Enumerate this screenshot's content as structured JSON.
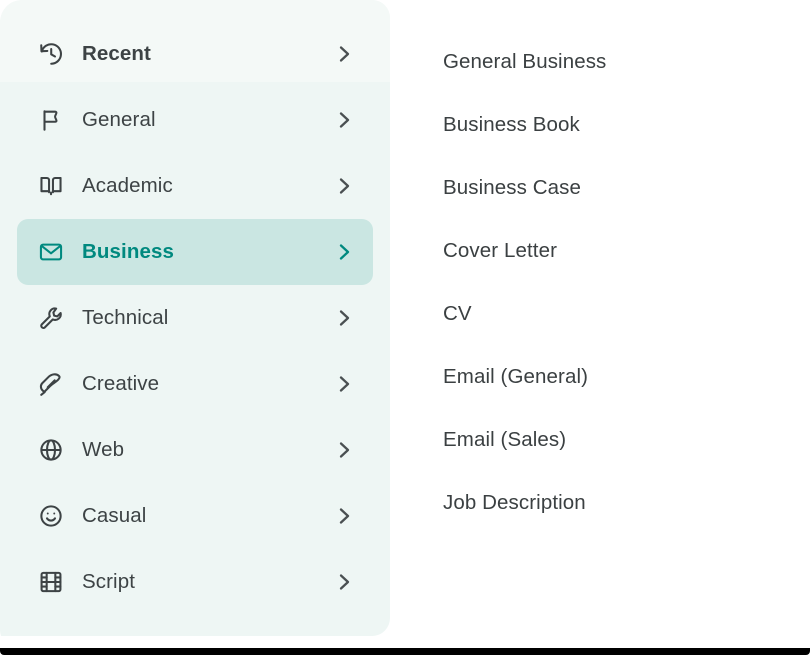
{
  "colors": {
    "sidebar_bg": "#eef6f4",
    "sidebar_top_band": "#f4f9f7",
    "active_row_bg": "#cae6e2",
    "accent_teal": "#00897f",
    "text_default": "#3d4345",
    "detail_bg": "#ffffff",
    "page_edge": "#000000"
  },
  "sidebar": {
    "items": [
      {
        "label": "Recent",
        "icon": "history-clock-icon",
        "chevron": "chevron-right-icon",
        "bold": true,
        "active": false
      },
      {
        "label": "General",
        "icon": "flag-icon",
        "chevron": "chevron-right-icon",
        "bold": false,
        "active": false
      },
      {
        "label": "Academic",
        "icon": "open-book-icon",
        "chevron": "chevron-right-icon",
        "bold": false,
        "active": false
      },
      {
        "label": "Business",
        "icon": "envelope-icon",
        "chevron": "chevron-right-icon",
        "bold": false,
        "active": true
      },
      {
        "label": "Technical",
        "icon": "wrench-icon",
        "chevron": "chevron-right-icon",
        "bold": false,
        "active": false
      },
      {
        "label": "Creative",
        "icon": "feather-quill-icon",
        "chevron": "chevron-right-icon",
        "bold": false,
        "active": false
      },
      {
        "label": "Web",
        "icon": "globe-icon",
        "chevron": "chevron-right-icon",
        "bold": false,
        "active": false
      },
      {
        "label": "Casual",
        "icon": "smiley-face-icon",
        "chevron": "chevron-right-icon",
        "bold": false,
        "active": false
      },
      {
        "label": "Script",
        "icon": "film-strip-icon",
        "chevron": "chevron-right-icon",
        "bold": false,
        "active": false
      }
    ]
  },
  "detail": {
    "selected_category": "Business",
    "items": [
      {
        "label": "General Business"
      },
      {
        "label": "Business Book"
      },
      {
        "label": "Business Case"
      },
      {
        "label": "Cover Letter"
      },
      {
        "label": "CV"
      },
      {
        "label": "Email (General)"
      },
      {
        "label": "Email (Sales)"
      },
      {
        "label": "Job Description"
      }
    ]
  }
}
